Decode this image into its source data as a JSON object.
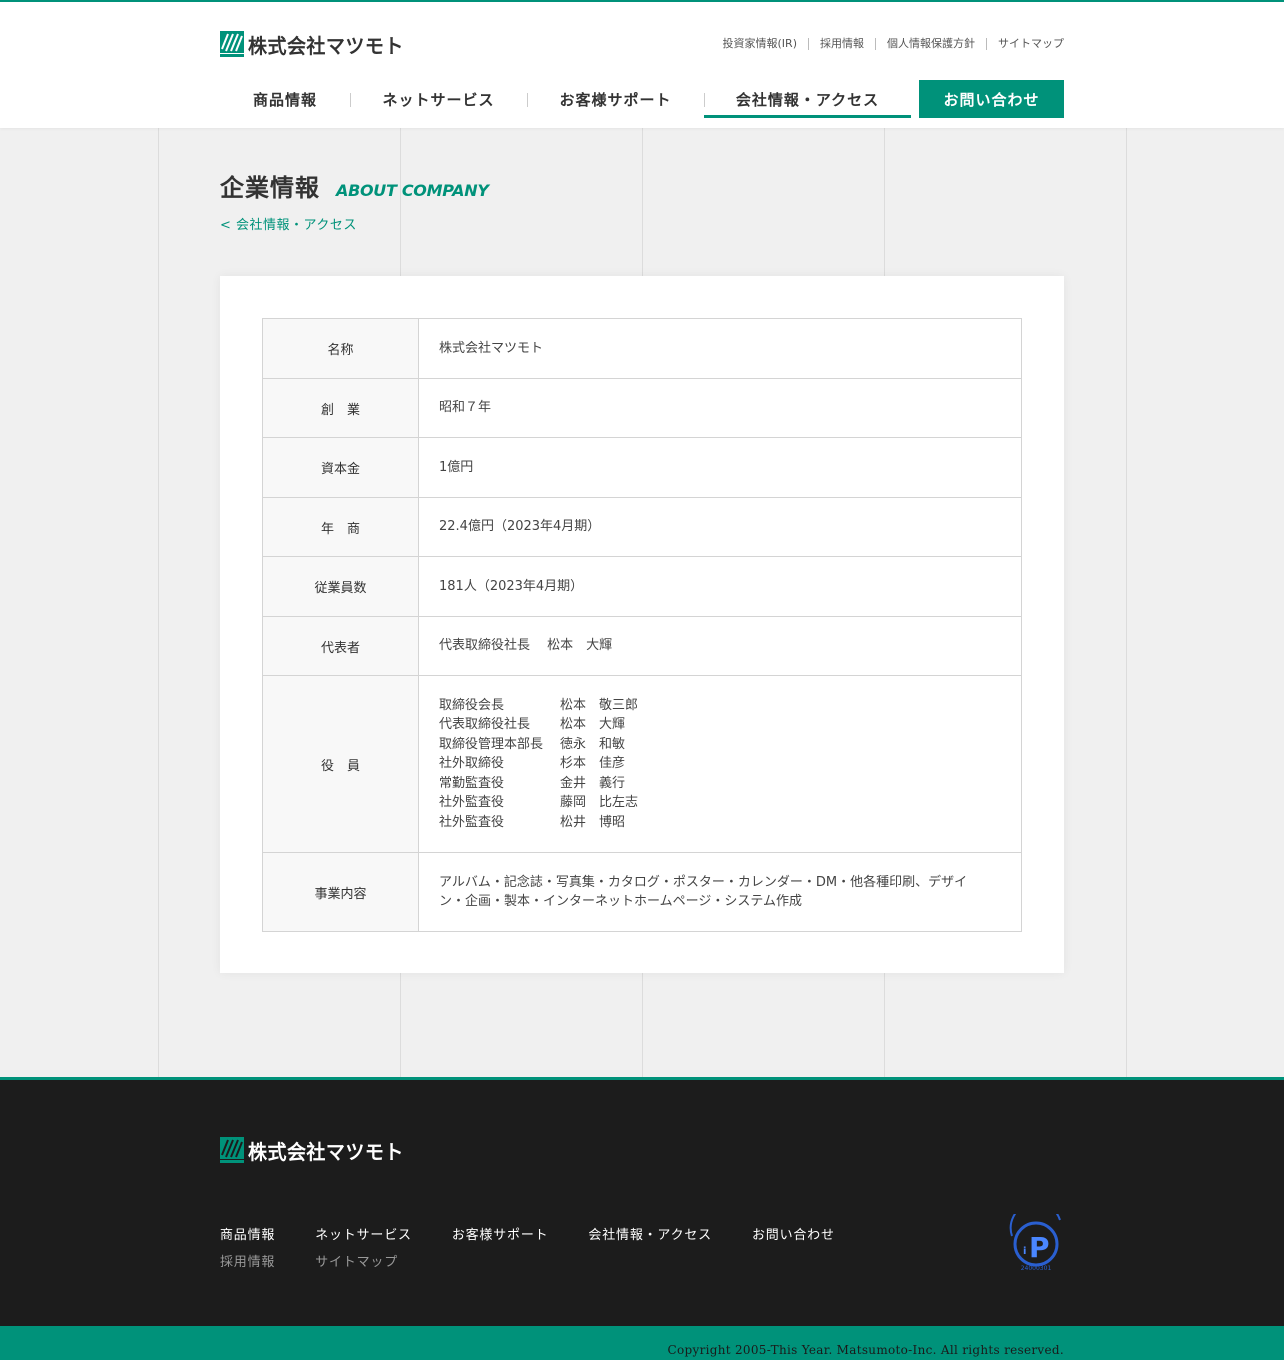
{
  "brand": {
    "logo_text": "株式会社マツモト",
    "accent_color": "#00927a"
  },
  "header": {
    "utility_nav": [
      "投資家情報(IR)",
      "採用情報",
      "個人情報保護方針",
      "サイトマップ"
    ],
    "global_nav": [
      {
        "label": "商品情報"
      },
      {
        "label": "ネットサービス"
      },
      {
        "label": "お客様サポート"
      },
      {
        "label": "会社情報・アクセス",
        "current": true
      }
    ],
    "contact_label": "お問い合わせ"
  },
  "page": {
    "title": "企業情報",
    "title_en": "ABOUT COMPANY",
    "breadcrumb": "< 会社情報・アクセス"
  },
  "company_table": {
    "rows": [
      {
        "label": "名称",
        "value": "株式会社マツモト"
      },
      {
        "label": "創　業",
        "value": "昭和７年"
      },
      {
        "label": "資本金",
        "value": "1億円"
      },
      {
        "label": "年　商",
        "value": "22.4億円（2023年4月期）"
      },
      {
        "label": "従業員数",
        "value": "181人（2023年4月期）"
      },
      {
        "label": "代表者",
        "value": "代表取締役社長　 松本　大輝"
      }
    ],
    "officers": {
      "label": "役　員",
      "list": [
        {
          "title": "取締役会長",
          "name": "松本　敬三郎"
        },
        {
          "title": "代表取締役社長",
          "name": "松本　大輝"
        },
        {
          "title": "取締役管理本部長",
          "name": "徳永　和敏"
        },
        {
          "title": "社外取締役",
          "name": "杉本　佳彦"
        },
        {
          "title": "常勤監査役",
          "name": "金井　義行"
        },
        {
          "title": "社外監査役",
          "name": "藤岡　比左志"
        },
        {
          "title": "社外監査役",
          "name": "松井　博昭"
        }
      ]
    },
    "business": {
      "label": "事業内容",
      "value": "アルバム・記念誌・写真集・カタログ・ポスター・カレンダー・DM・他各種印刷、デザイン・企画・製本・インターネットホームページ・システム作成"
    }
  },
  "footer": {
    "logo_text": "株式会社マツモト",
    "nav_primary": [
      "商品情報",
      "ネットサービス",
      "お客様サポート",
      "会社情報・アクセス",
      "お問い合わせ"
    ],
    "nav_secondary": [
      "採用情報",
      "サイトマップ"
    ],
    "privacy_mark_number": "24000301",
    "copyright": "Copyright 2005-This Year. Matsumoto-Inc. All rights reserved."
  }
}
